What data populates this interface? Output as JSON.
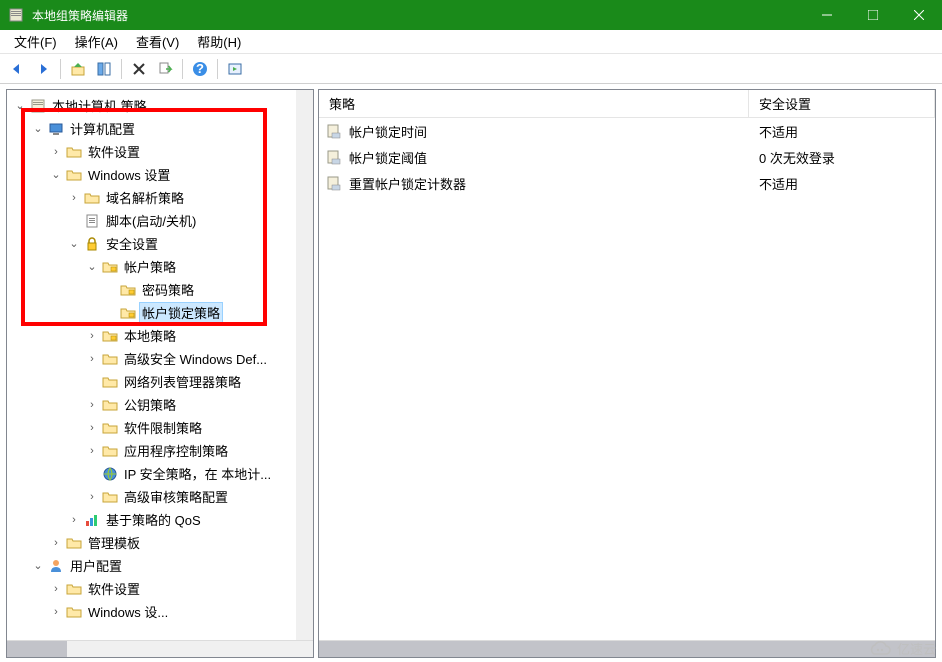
{
  "window": {
    "title": "本地组策略编辑器",
    "btn_min": "minimize",
    "btn_max": "maximize",
    "btn_close": "close"
  },
  "menu": {
    "file": "文件(F)",
    "action": "操作(A)",
    "view": "查看(V)",
    "help": "帮助(H)"
  },
  "tree": {
    "root": "本地计算机 策略",
    "computer_config": "计算机配置",
    "software_settings": "软件设置",
    "windows_settings": "Windows 设置",
    "dns_policy": "域名解析策略",
    "scripts": "脚本(启动/关机)",
    "security_settings": "安全设置",
    "account_policy": "帐户策略",
    "password_policy": "密码策略",
    "account_lockout_policy": "帐户锁定策略",
    "local_policy": "本地策略",
    "adv_firewall": "高级安全 Windows Def...",
    "network_list": "网络列表管理器策略",
    "public_key": "公钥策略",
    "software_restriction": "软件限制策略",
    "app_control": "应用程序控制策略",
    "ip_security": "IP 安全策略，在 本地计...",
    "adv_audit": "高级审核策略配置",
    "qos": "基于策略的 QoS",
    "admin_templates_c": "管理模板",
    "user_config": "用户配置",
    "software_settings_u": "软件设置",
    "windows_settings_u": "Windows 设..."
  },
  "detail": {
    "col_policy": "策略",
    "col_setting": "安全设置",
    "rows": [
      {
        "name": "帐户锁定时间",
        "value": "不适用"
      },
      {
        "name": "帐户锁定阈值",
        "value": "0 次无效登录"
      },
      {
        "name": "重置帐户锁定计数器",
        "value": "不适用"
      }
    ]
  },
  "watermark": "亿速云"
}
